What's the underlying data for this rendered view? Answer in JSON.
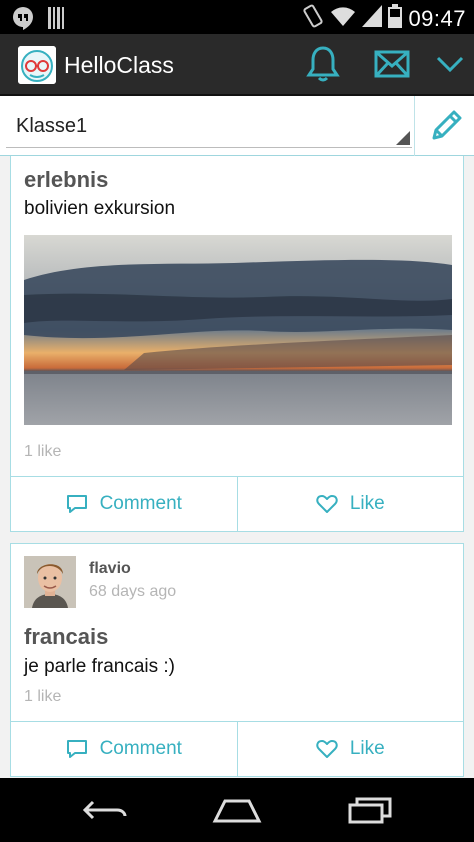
{
  "status_bar": {
    "time": "09:47",
    "icons": [
      "hangouts-icon",
      "barcode-icon",
      "vibrate-icon",
      "wifi-icon",
      "signal-icon",
      "battery-icon"
    ]
  },
  "app_bar": {
    "title": "HelloClass",
    "actions": [
      "bell-icon",
      "mail-icon",
      "chevron-down-icon"
    ],
    "accent": "#37b0c0"
  },
  "class_selector": {
    "value": "Klasse1"
  },
  "posts": [
    {
      "title": "erlebnis",
      "body": "bolivien exkursion",
      "likes": "1 like",
      "comment_label": "Comment",
      "like_label": "Like"
    },
    {
      "author": "flavio",
      "time": "68 days ago",
      "title": "francais",
      "body": "je parle francais :)",
      "likes": "1 like",
      "comment_label": "Comment",
      "like_label": "Like"
    }
  ],
  "nav_bar": {
    "buttons": [
      "back-icon",
      "home-icon",
      "recents-icon"
    ]
  }
}
